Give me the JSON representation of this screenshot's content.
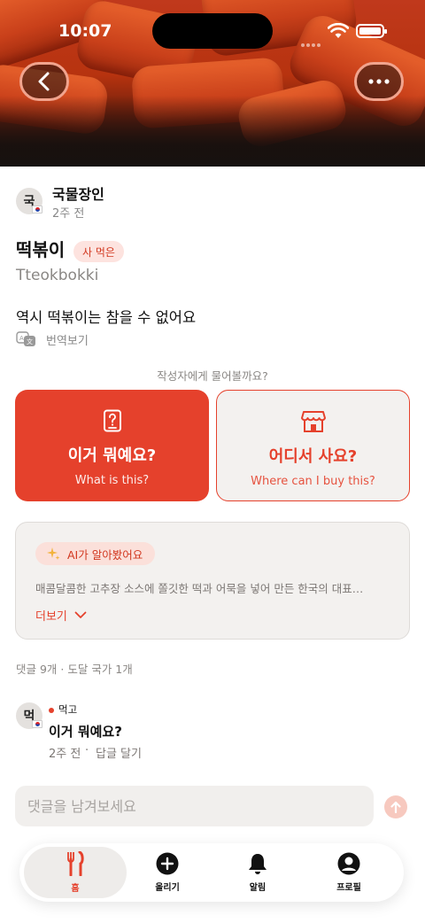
{
  "status_bar": {
    "time": "10:07"
  },
  "author": {
    "avatar_initial": "국",
    "name": "국물장인",
    "posted": "2주 전"
  },
  "post": {
    "title": "떡볶이",
    "tag": "사 먹은",
    "romanized": "Tteokbokki",
    "body": "역시 떡볶이는 참을 수 없어요",
    "translate_label": "번역보기"
  },
  "ask": {
    "prompt": "작성자에게 물어볼까요?",
    "what": {
      "title": "이거 뭐예요?",
      "subtitle": "What is this?"
    },
    "where": {
      "title": "어디서 사요?",
      "subtitle": "Where can I buy this?"
    }
  },
  "ai": {
    "label": "AI가 알아봤어요",
    "summary": "매콤달콤한 고추장 소스에 쫄깃한 떡과 어묵을 넣어 만든 한국의 대표…",
    "more": "더보기"
  },
  "comments": {
    "summary": "댓글 9개 · 도달 국가 1개",
    "items": [
      {
        "avatar_initial": "먹",
        "user": "먹고",
        "text": "이거 뭐예요?",
        "time": "2주 전",
        "reply": "답글 달기"
      }
    ]
  },
  "comment_input": {
    "placeholder": "댓글을 남겨보세요"
  },
  "tabbar": {
    "tabs": [
      {
        "label": "홈"
      },
      {
        "label": "올리기"
      },
      {
        "label": "알림"
      },
      {
        "label": "프로필"
      }
    ]
  },
  "colors": {
    "accent": "#e5412c",
    "accent_soft": "#fde3df",
    "card_bg": "#f3f1ef"
  }
}
